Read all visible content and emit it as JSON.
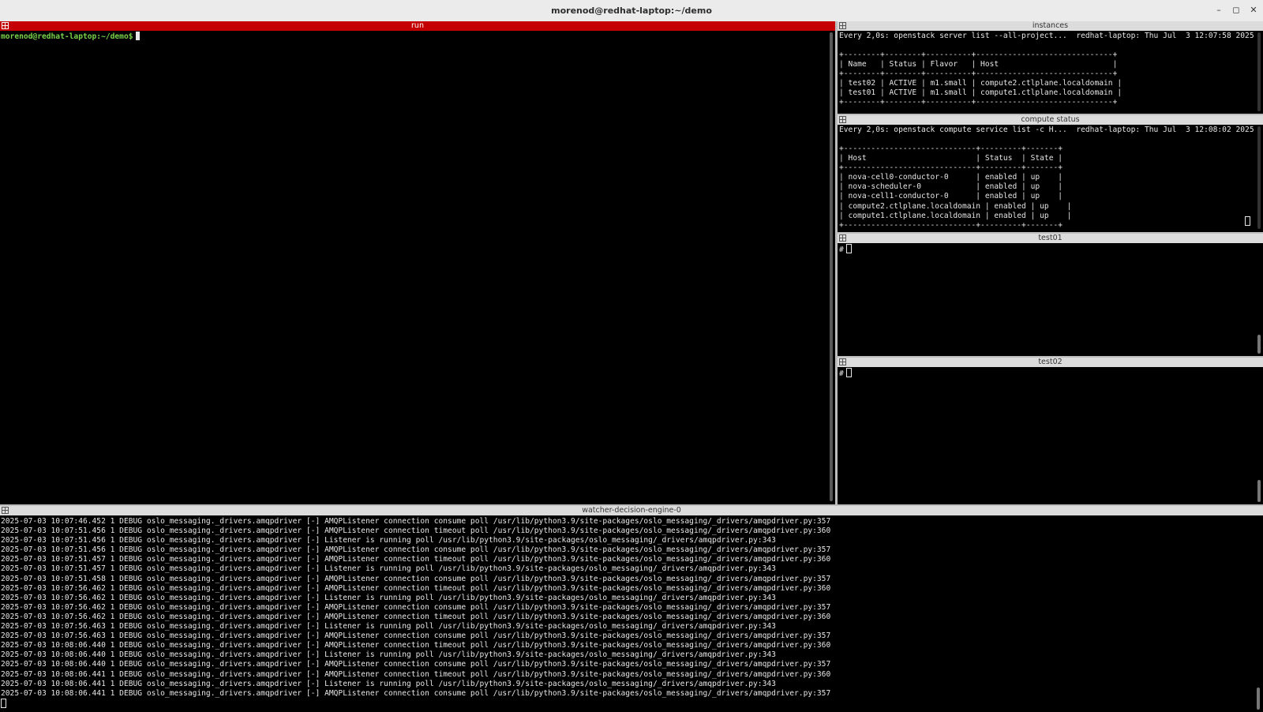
{
  "window": {
    "title": "morenod@redhat-laptop:~/demo",
    "minimize": "–",
    "maximize": "◻",
    "close": "✕"
  },
  "panes": {
    "run": {
      "title": "run",
      "prompt": "morenod@redhat-laptop:~/demo$"
    },
    "instances": {
      "title": "instances",
      "header": "Every 2,0s: openstack server list --all-project...  redhat-laptop: Thu Jul  3 12:07:58 2025",
      "table": "+--------+--------+----------+------------------------------+\n| Name   | Status | Flavor   | Host                         |\n+--------+--------+----------+------------------------------+\n| test02 | ACTIVE | m1.small | compute2.ctlplane.localdomain |\n| test01 | ACTIVE | m1.small | compute1.ctlplane.localdomain |\n+--------+--------+----------+------------------------------+"
    },
    "compute_status": {
      "title": "compute status",
      "header": "Every 2,0s: openstack compute service list -c H...  redhat-laptop: Thu Jul  3 12:08:02 2025",
      "table": "+-----------------------------+---------+-------+\n| Host                        | Status  | State |\n+-----------------------------+---------+-------+\n| nova-cell0-conductor-0      | enabled | up    |\n| nova-scheduler-0            | enabled | up    |\n| nova-cell1-conductor-0      | enabled | up    |\n| compute2.ctlplane.localdomain | enabled | up    |\n| compute1.ctlplane.localdomain | enabled | up    |\n+-----------------------------+---------+-------+"
    },
    "test01": {
      "title": "test01",
      "prompt": "#"
    },
    "test02": {
      "title": "test02",
      "prompt": "#"
    },
    "watcher": {
      "title": "watcher-decision-engine-0",
      "log": "2025-07-03 10:07:46.452 1 DEBUG oslo_messaging._drivers.amqpdriver [-] AMQPListener connection consume poll /usr/lib/python3.9/site-packages/oslo_messaging/_drivers/amqpdriver.py:357\n2025-07-03 10:07:51.456 1 DEBUG oslo_messaging._drivers.amqpdriver [-] AMQPListener connection timeout poll /usr/lib/python3.9/site-packages/oslo_messaging/_drivers/amqpdriver.py:360\n2025-07-03 10:07:51.456 1 DEBUG oslo_messaging._drivers.amqpdriver [-] Listener is running poll /usr/lib/python3.9/site-packages/oslo_messaging/_drivers/amqpdriver.py:343\n2025-07-03 10:07:51.456 1 DEBUG oslo_messaging._drivers.amqpdriver [-] AMQPListener connection consume poll /usr/lib/python3.9/site-packages/oslo_messaging/_drivers/amqpdriver.py:357\n2025-07-03 10:07:51.457 1 DEBUG oslo_messaging._drivers.amqpdriver [-] AMQPListener connection timeout poll /usr/lib/python3.9/site-packages/oslo_messaging/_drivers/amqpdriver.py:360\n2025-07-03 10:07:51.457 1 DEBUG oslo_messaging._drivers.amqpdriver [-] Listener is running poll /usr/lib/python3.9/site-packages/oslo_messaging/_drivers/amqpdriver.py:343\n2025-07-03 10:07:51.458 1 DEBUG oslo_messaging._drivers.amqpdriver [-] AMQPListener connection consume poll /usr/lib/python3.9/site-packages/oslo_messaging/_drivers/amqpdriver.py:357\n2025-07-03 10:07:56.462 1 DEBUG oslo_messaging._drivers.amqpdriver [-] AMQPListener connection timeout poll /usr/lib/python3.9/site-packages/oslo_messaging/_drivers/amqpdriver.py:360\n2025-07-03 10:07:56.462 1 DEBUG oslo_messaging._drivers.amqpdriver [-] Listener is running poll /usr/lib/python3.9/site-packages/oslo_messaging/_drivers/amqpdriver.py:343\n2025-07-03 10:07:56.462 1 DEBUG oslo_messaging._drivers.amqpdriver [-] AMQPListener connection consume poll /usr/lib/python3.9/site-packages/oslo_messaging/_drivers/amqpdriver.py:357\n2025-07-03 10:07:56.462 1 DEBUG oslo_messaging._drivers.amqpdriver [-] AMQPListener connection timeout poll /usr/lib/python3.9/site-packages/oslo_messaging/_drivers/amqpdriver.py:360\n2025-07-03 10:07:56.463 1 DEBUG oslo_messaging._drivers.amqpdriver [-] Listener is running poll /usr/lib/python3.9/site-packages/oslo_messaging/_drivers/amqpdriver.py:343\n2025-07-03 10:07:56.463 1 DEBUG oslo_messaging._drivers.amqpdriver [-] AMQPListener connection consume poll /usr/lib/python3.9/site-packages/oslo_messaging/_drivers/amqpdriver.py:357\n2025-07-03 10:08:06.440 1 DEBUG oslo_messaging._drivers.amqpdriver [-] AMQPListener connection timeout poll /usr/lib/python3.9/site-packages/oslo_messaging/_drivers/amqpdriver.py:360\n2025-07-03 10:08:06.440 1 DEBUG oslo_messaging._drivers.amqpdriver [-] Listener is running poll /usr/lib/python3.9/site-packages/oslo_messaging/_drivers/amqpdriver.py:343\n2025-07-03 10:08:06.440 1 DEBUG oslo_messaging._drivers.amqpdriver [-] AMQPListener connection consume poll /usr/lib/python3.9/site-packages/oslo_messaging/_drivers/amqpdriver.py:357\n2025-07-03 10:08:06.441 1 DEBUG oslo_messaging._drivers.amqpdriver [-] AMQPListener connection timeout poll /usr/lib/python3.9/site-packages/oslo_messaging/_drivers/amqpdriver.py:360\n2025-07-03 10:08:06.441 1 DEBUG oslo_messaging._drivers.amqpdriver [-] Listener is running poll /usr/lib/python3.9/site-packages/oslo_messaging/_drivers/amqpdriver.py:343\n2025-07-03 10:08:06.441 1 DEBUG oslo_messaging._drivers.amqpdriver [-] AMQPListener connection consume poll /usr/lib/python3.9/site-packages/oslo_messaging/_drivers/amqpdriver.py:357"
    }
  },
  "colors": {
    "run_title_bg": "#c40000",
    "prompt": "#78d14a",
    "pane_title_bg": "#dcdcdc"
  }
}
